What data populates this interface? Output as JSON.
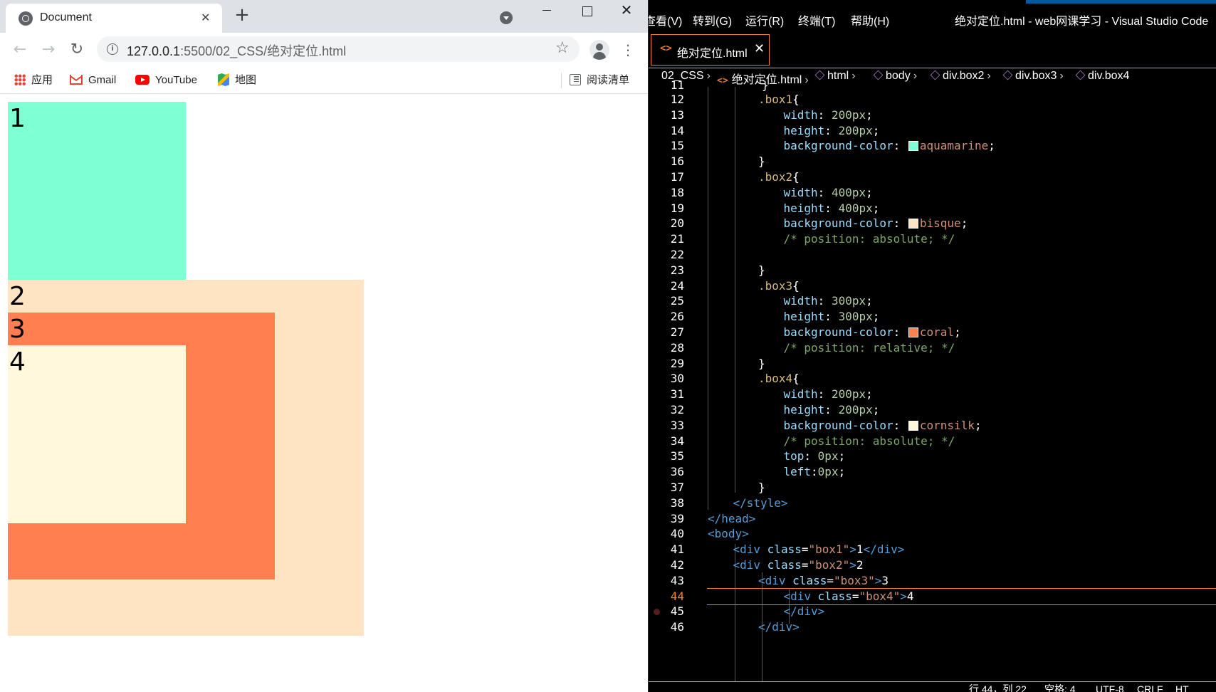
{
  "browser": {
    "tab_title": "Document",
    "url_host": "127.0.0.1",
    "url_path": ":5500/02_CSS/绝对定位.html",
    "bookmarks": {
      "apps": "应用",
      "gmail": "Gmail",
      "youtube": "YouTube",
      "maps": "地图",
      "reading_list": "阅读清单"
    },
    "page": {
      "box1_text": "1",
      "box2_text": "2",
      "box3_text": "3",
      "box4_text": "4"
    }
  },
  "editor": {
    "menu": [
      "查看(V)",
      "转到(G)",
      "运行(R)",
      "终端(T)",
      "帮助(H)"
    ],
    "window_title": "绝对定位.html - web网课学习 - Visual Studio Code",
    "tab_label": "绝对定位.html",
    "breadcrumb": [
      "02_CSS",
      "绝对定位.html",
      "html",
      "body",
      "div.box2",
      "div.box3",
      "div.box4"
    ],
    "active_line": 44,
    "lines": [
      {
        "n": 12,
        "indent": 2,
        "tokens": [
          [
            "sel",
            ".box1"
          ],
          [
            "pun",
            "{"
          ]
        ]
      },
      {
        "n": 13,
        "indent": 3,
        "tokens": [
          [
            "prop",
            "width"
          ],
          [
            "pun",
            ": "
          ],
          [
            "num",
            "200px"
          ],
          [
            "pun",
            ";"
          ]
        ]
      },
      {
        "n": 14,
        "indent": 3,
        "tokens": [
          [
            "prop",
            "height"
          ],
          [
            "pun",
            ": "
          ],
          [
            "num",
            "200px"
          ],
          [
            "pun",
            ";"
          ]
        ]
      },
      {
        "n": 15,
        "indent": 3,
        "tokens": [
          [
            "prop",
            "background-color"
          ],
          [
            "pun",
            ": "
          ],
          [
            "swatch",
            "#7fffd4"
          ],
          [
            "val",
            "aquamarine"
          ],
          [
            "pun",
            ";"
          ]
        ]
      },
      {
        "n": 16,
        "indent": 2,
        "tokens": [
          [
            "pun",
            "}"
          ]
        ]
      },
      {
        "n": 17,
        "indent": 2,
        "tokens": [
          [
            "sel",
            ".box2"
          ],
          [
            "pun",
            "{"
          ]
        ]
      },
      {
        "n": 18,
        "indent": 3,
        "tokens": [
          [
            "prop",
            "width"
          ],
          [
            "pun",
            ": "
          ],
          [
            "num",
            "400px"
          ],
          [
            "pun",
            ";"
          ]
        ]
      },
      {
        "n": 19,
        "indent": 3,
        "tokens": [
          [
            "prop",
            "height"
          ],
          [
            "pun",
            ": "
          ],
          [
            "num",
            "400px"
          ],
          [
            "pun",
            ";"
          ]
        ]
      },
      {
        "n": 20,
        "indent": 3,
        "tokens": [
          [
            "prop",
            "background-color"
          ],
          [
            "pun",
            ": "
          ],
          [
            "swatch",
            "#ffe4c4"
          ],
          [
            "val",
            "bisque"
          ],
          [
            "pun",
            ";"
          ]
        ]
      },
      {
        "n": 21,
        "indent": 3,
        "tokens": [
          [
            "com",
            "/* position: absolute; */"
          ]
        ]
      },
      {
        "n": 22,
        "indent": 3,
        "tokens": []
      },
      {
        "n": 23,
        "indent": 2,
        "tokens": [
          [
            "pun",
            "}"
          ]
        ]
      },
      {
        "n": 24,
        "indent": 2,
        "tokens": [
          [
            "sel",
            ".box3"
          ],
          [
            "pun",
            "{"
          ]
        ]
      },
      {
        "n": 25,
        "indent": 3,
        "tokens": [
          [
            "prop",
            "width"
          ],
          [
            "pun",
            ": "
          ],
          [
            "num",
            "300px"
          ],
          [
            "pun",
            ";"
          ]
        ]
      },
      {
        "n": 26,
        "indent": 3,
        "tokens": [
          [
            "prop",
            "height"
          ],
          [
            "pun",
            ": "
          ],
          [
            "num",
            "300px"
          ],
          [
            "pun",
            ";"
          ]
        ]
      },
      {
        "n": 27,
        "indent": 3,
        "tokens": [
          [
            "prop",
            "background-color"
          ],
          [
            "pun",
            ": "
          ],
          [
            "swatch",
            "#ff7f50"
          ],
          [
            "val",
            "coral"
          ],
          [
            "pun",
            ";"
          ]
        ]
      },
      {
        "n": 28,
        "indent": 3,
        "tokens": [
          [
            "com",
            "/* position: relative; */"
          ]
        ]
      },
      {
        "n": 29,
        "indent": 2,
        "tokens": [
          [
            "pun",
            "}"
          ]
        ]
      },
      {
        "n": 30,
        "indent": 2,
        "tokens": [
          [
            "sel",
            ".box4"
          ],
          [
            "pun",
            "{"
          ]
        ]
      },
      {
        "n": 31,
        "indent": 3,
        "tokens": [
          [
            "prop",
            "width"
          ],
          [
            "pun",
            ": "
          ],
          [
            "num",
            "200px"
          ],
          [
            "pun",
            ";"
          ]
        ]
      },
      {
        "n": 32,
        "indent": 3,
        "tokens": [
          [
            "prop",
            "height"
          ],
          [
            "pun",
            ": "
          ],
          [
            "num",
            "200px"
          ],
          [
            "pun",
            ";"
          ]
        ]
      },
      {
        "n": 33,
        "indent": 3,
        "tokens": [
          [
            "prop",
            "background-color"
          ],
          [
            "pun",
            ": "
          ],
          [
            "swatch",
            "#fff8dc"
          ],
          [
            "val",
            "cornsilk"
          ],
          [
            "pun",
            ";"
          ]
        ]
      },
      {
        "n": 34,
        "indent": 3,
        "tokens": [
          [
            "com",
            "/* position: absolute; */"
          ]
        ]
      },
      {
        "n": 35,
        "indent": 3,
        "tokens": [
          [
            "prop",
            "top"
          ],
          [
            "pun",
            ": "
          ],
          [
            "num",
            "0px"
          ],
          [
            "pun",
            ";"
          ]
        ]
      },
      {
        "n": 36,
        "indent": 3,
        "tokens": [
          [
            "prop",
            "left"
          ],
          [
            "pun",
            ":"
          ],
          [
            "num",
            "0px"
          ],
          [
            "pun",
            ";"
          ]
        ]
      },
      {
        "n": 37,
        "indent": 2,
        "tokens": [
          [
            "pun",
            "}"
          ]
        ]
      },
      {
        "n": 38,
        "indent": 1,
        "tokens": [
          [
            "tag",
            "</style>"
          ]
        ]
      },
      {
        "n": 39,
        "indent": 0,
        "tokens": [
          [
            "tag",
            "</head>"
          ]
        ]
      },
      {
        "n": 40,
        "indent": 0,
        "tokens": [
          [
            "tag",
            "<body>"
          ]
        ]
      },
      {
        "n": 41,
        "indent": 1,
        "tokens": [
          [
            "tag",
            "<div "
          ],
          [
            "attr",
            "class"
          ],
          [
            "pun",
            "="
          ],
          [
            "str",
            "\"box1\""
          ],
          [
            "tag",
            ">"
          ],
          [
            "txt",
            "1"
          ],
          [
            "tag",
            "</div>"
          ]
        ]
      },
      {
        "n": 42,
        "indent": 1,
        "tokens": [
          [
            "tag",
            "<div "
          ],
          [
            "attr",
            "class"
          ],
          [
            "pun",
            "="
          ],
          [
            "str",
            "\"box2\""
          ],
          [
            "tag",
            ">"
          ],
          [
            "txt",
            "2"
          ]
        ]
      },
      {
        "n": 43,
        "indent": 2,
        "tokens": [
          [
            "tag",
            "<div "
          ],
          [
            "attr",
            "class"
          ],
          [
            "pun",
            "="
          ],
          [
            "str",
            "\"box3\""
          ],
          [
            "tag",
            ">"
          ],
          [
            "txt",
            "3"
          ]
        ]
      },
      {
        "n": 44,
        "indent": 3,
        "tokens": [
          [
            "tag",
            "<div "
          ],
          [
            "attr",
            "class"
          ],
          [
            "pun",
            "="
          ],
          [
            "str",
            "\"box4\""
          ],
          [
            "tag",
            ">"
          ],
          [
            "txt",
            "4"
          ]
        ]
      },
      {
        "n": 45,
        "indent": 3,
        "tokens": [
          [
            "tag",
            "</div>"
          ]
        ]
      },
      {
        "n": 46,
        "indent": 2,
        "tokens": [
          [
            "tag",
            "</div>"
          ]
        ]
      }
    ],
    "status": {
      "position": "行 44，列 22",
      "spaces": "空格: 4",
      "encoding": "UTF-8",
      "eol": "CRLF",
      "lang": "HT"
    }
  }
}
